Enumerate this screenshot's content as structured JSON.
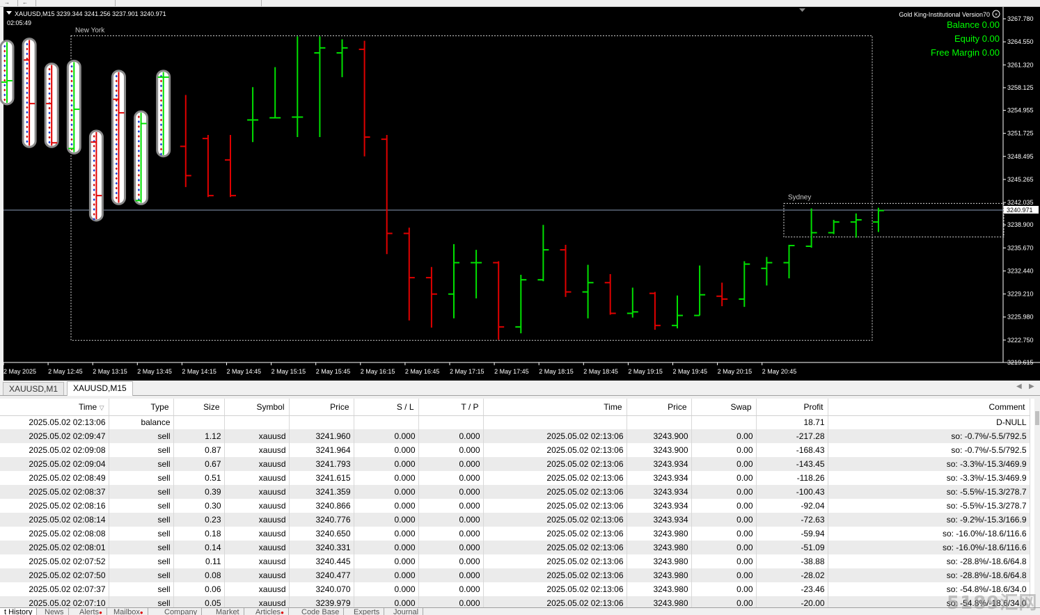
{
  "top_toolbar": {
    "items": [
      "→",
      "←"
    ]
  },
  "chart": {
    "symbol_info": "XAUUSD,M15  3239.344 3241.256 3237.901 3240.971",
    "countdown": "02:05:49",
    "indicator_name": "Gold King-Institutional Version70",
    "balance": "Balance 0.00",
    "equity": "Equity 0.00",
    "free_margin": "Free Margin 0.00",
    "sessions": [
      "New York",
      "Sydney"
    ],
    "current_price_label": "3240.971",
    "colors": {
      "bull": "#00e000",
      "bear": "#e00000",
      "info": "#00ff00",
      "grid": "#ffffff",
      "price_line": "#8a9bb8"
    }
  },
  "chart_data": {
    "type": "ohlc",
    "title": "XAUUSD,M15",
    "ylim": [
      3219.615,
      3267.78
    ],
    "y_ticks": [
      "3267.780",
      "3264.550",
      "3261.320",
      "3258.125",
      "3254.955",
      "3251.725",
      "3248.495",
      "3245.265",
      "3242.035",
      "3238.900",
      "3235.670",
      "3232.440",
      "3229.210",
      "3225.980",
      "3222.750",
      "3219.615"
    ],
    "x_ticks": [
      "2 May 2025",
      "2 May 12:45",
      "2 May 13:15",
      "2 May 13:45",
      "2 May 14:15",
      "2 May 14:45",
      "2 May 15:15",
      "2 May 15:45",
      "2 May 16:15",
      "2 May 16:45",
      "2 May 17:15",
      "2 May 17:45",
      "2 May 18:15",
      "2 May 18:45",
      "2 May 19:15",
      "2 May 19:45",
      "2 May 20:15",
      "2 May 20:45"
    ],
    "bars": [
      {
        "o": 3258.9,
        "h": 3264.5,
        "l": 3256.0,
        "c": 3259.1
      },
      {
        "o": 3262.0,
        "h": 3264.8,
        "l": 3250.0,
        "c": 3255.9
      },
      {
        "o": 3255.9,
        "h": 3261.3,
        "l": 3250.0,
        "c": 3250.4
      },
      {
        "o": 3249.6,
        "h": 3261.7,
        "l": 3249.1,
        "c": 3255.1
      },
      {
        "o": 3250.5,
        "h": 3251.9,
        "l": 3239.7,
        "c": 3243.0
      },
      {
        "o": 3256.5,
        "h": 3260.3,
        "l": 3242.0,
        "c": 3254.6
      },
      {
        "o": 3242.3,
        "h": 3254.6,
        "l": 3242.0,
        "c": 3253.1
      },
      {
        "o": 3259.6,
        "h": 3260.3,
        "l": 3248.7,
        "c": 3259.6
      },
      {
        "o": 3249.9,
        "h": 3257.1,
        "l": 3244.2,
        "c": 3245.8
      },
      {
        "o": 3251.0,
        "h": 3251.5,
        "l": 3242.8,
        "c": 3243.0
      },
      {
        "o": 3248.0,
        "h": 3251.5,
        "l": 3242.8,
        "c": 3243.0
      },
      {
        "o": 3253.6,
        "h": 3258.2,
        "l": 3250.5,
        "c": 3253.6
      },
      {
        "o": 3253.9,
        "h": 3261.0,
        "l": 3253.9,
        "c": 3253.9
      },
      {
        "o": 3254.0,
        "h": 3265.3,
        "l": 3251.2,
        "c": 3254.0
      },
      {
        "o": 3263.0,
        "h": 3265.3,
        "l": 3251.2,
        "c": 3263.7
      },
      {
        "o": 3263.0,
        "h": 3264.9,
        "l": 3259.6,
        "c": 3263.7
      },
      {
        "o": 3263.5,
        "h": 3264.7,
        "l": 3248.5,
        "c": 3251.2
      },
      {
        "o": 3250.9,
        "h": 3251.5,
        "l": 3234.8,
        "c": 3237.7
      },
      {
        "o": 3237.7,
        "h": 3238.5,
        "l": 3225.5,
        "c": 3231.5
      },
      {
        "o": 3231.5,
        "h": 3233.0,
        "l": 3224.5,
        "c": 3229.2
      },
      {
        "o": 3229.2,
        "h": 3236.2,
        "l": 3225.8,
        "c": 3233.6
      },
      {
        "o": 3233.6,
        "h": 3235.4,
        "l": 3228.6,
        "c": 3233.6
      },
      {
        "o": 3233.6,
        "h": 3233.8,
        "l": 3222.8,
        "c": 3224.6
      },
      {
        "o": 3224.6,
        "h": 3231.9,
        "l": 3223.7,
        "c": 3231.2
      },
      {
        "o": 3231.2,
        "h": 3238.9,
        "l": 3231.0,
        "c": 3235.4
      },
      {
        "o": 3235.4,
        "h": 3236.1,
        "l": 3228.8,
        "c": 3229.5
      },
      {
        "o": 3229.5,
        "h": 3233.3,
        "l": 3225.8,
        "c": 3230.8
      },
      {
        "o": 3230.8,
        "h": 3232.0,
        "l": 3226.3,
        "c": 3226.5
      },
      {
        "o": 3226.5,
        "h": 3230.1,
        "l": 3225.9,
        "c": 3226.7
      },
      {
        "o": 3229.3,
        "h": 3229.5,
        "l": 3224.2,
        "c": 3224.8
      },
      {
        "o": 3224.8,
        "h": 3229.0,
        "l": 3224.4,
        "c": 3226.2
      },
      {
        "o": 3226.2,
        "h": 3233.2,
        "l": 3226.2,
        "c": 3229.1
      },
      {
        "o": 3228.9,
        "h": 3230.8,
        "l": 3227.5,
        "c": 3228.5
      },
      {
        "o": 3228.5,
        "h": 3233.8,
        "l": 3227.4,
        "c": 3233.4
      },
      {
        "o": 3232.8,
        "h": 3234.4,
        "l": 3230.4,
        "c": 3233.6
      },
      {
        "o": 3233.6,
        "h": 3236.1,
        "l": 3231.4,
        "c": 3236.0
      },
      {
        "o": 3235.9,
        "h": 3241.2,
        "l": 3235.7,
        "c": 3237.8
      },
      {
        "o": 3237.8,
        "h": 3239.6,
        "l": 3237.6,
        "c": 3239.3
      },
      {
        "o": 3239.3,
        "h": 3240.5,
        "l": 3237.1,
        "c": 3239.6
      },
      {
        "o": 3239.3,
        "h": 3241.3,
        "l": 3237.9,
        "c": 3240.9
      }
    ]
  },
  "symbol_tabs": [
    "XAUUSD,M1",
    "XAUUSD,M15"
  ],
  "table": {
    "headers": [
      "Time",
      "Type",
      "Size",
      "Symbol",
      "Price",
      "S / L",
      "T / P",
      "Time",
      "Price",
      "Swap",
      "Profit",
      "Comment"
    ],
    "rows": [
      [
        "2025.05.02 02:13:06",
        "balance",
        "",
        "",
        "",
        "",
        "",
        "",
        "",
        "",
        "18.71",
        "D-NULL"
      ],
      [
        "2025.05.02 02:09:47",
        "sell",
        "1.12",
        "xauusd",
        "3241.960",
        "0.000",
        "0.000",
        "2025.05.02 02:13:06",
        "3243.900",
        "0.00",
        "-217.28",
        "so: -0.7%/-5.5/792.5"
      ],
      [
        "2025.05.02 02:09:08",
        "sell",
        "0.87",
        "xauusd",
        "3241.964",
        "0.000",
        "0.000",
        "2025.05.02 02:13:06",
        "3243.900",
        "0.00",
        "-168.43",
        "so: -0.7%/-5.5/792.5"
      ],
      [
        "2025.05.02 02:09:04",
        "sell",
        "0.67",
        "xauusd",
        "3241.793",
        "0.000",
        "0.000",
        "2025.05.02 02:13:06",
        "3243.934",
        "0.00",
        "-143.45",
        "so: -3.3%/-15.3/469.9"
      ],
      [
        "2025.05.02 02:08:49",
        "sell",
        "0.51",
        "xauusd",
        "3241.615",
        "0.000",
        "0.000",
        "2025.05.02 02:13:06",
        "3243.934",
        "0.00",
        "-118.26",
        "so: -3.3%/-15.3/469.9"
      ],
      [
        "2025.05.02 02:08:37",
        "sell",
        "0.39",
        "xauusd",
        "3241.359",
        "0.000",
        "0.000",
        "2025.05.02 02:13:06",
        "3243.934",
        "0.00",
        "-100.43",
        "so: -5.5%/-15.3/278.7"
      ],
      [
        "2025.05.02 02:08:16",
        "sell",
        "0.30",
        "xauusd",
        "3240.866",
        "0.000",
        "0.000",
        "2025.05.02 02:13:06",
        "3243.934",
        "0.00",
        "-92.04",
        "so: -5.5%/-15.3/278.7"
      ],
      [
        "2025.05.02 02:08:14",
        "sell",
        "0.23",
        "xauusd",
        "3240.776",
        "0.000",
        "0.000",
        "2025.05.02 02:13:06",
        "3243.934",
        "0.00",
        "-72.63",
        "so: -9.2%/-15.3/166.9"
      ],
      [
        "2025.05.02 02:08:08",
        "sell",
        "0.18",
        "xauusd",
        "3240.650",
        "0.000",
        "0.000",
        "2025.05.02 02:13:06",
        "3243.980",
        "0.00",
        "-59.94",
        "so: -16.0%/-18.6/116.6"
      ],
      [
        "2025.05.02 02:08:01",
        "sell",
        "0.14",
        "xauusd",
        "3240.331",
        "0.000",
        "0.000",
        "2025.05.02 02:13:06",
        "3243.980",
        "0.00",
        "-51.09",
        "so: -16.0%/-18.6/116.6"
      ],
      [
        "2025.05.02 02:07:52",
        "sell",
        "0.11",
        "xauusd",
        "3240.445",
        "0.000",
        "0.000",
        "2025.05.02 02:13:06",
        "3243.980",
        "0.00",
        "-38.88",
        "so: -28.8%/-18.6/64.8"
      ],
      [
        "2025.05.02 02:07:50",
        "sell",
        "0.08",
        "xauusd",
        "3240.477",
        "0.000",
        "0.000",
        "2025.05.02 02:13:06",
        "3243.980",
        "0.00",
        "-28.02",
        "so: -28.8%/-18.6/64.8"
      ],
      [
        "2025.05.02 02:07:37",
        "sell",
        "0.06",
        "xauusd",
        "3240.070",
        "0.000",
        "0.000",
        "2025.05.02 02:13:06",
        "3243.980",
        "0.00",
        "-23.46",
        "so: -54.8%/-18.6/34.0"
      ],
      [
        "2025.05.02 02:07:10",
        "sell",
        "0.05",
        "xauusd",
        "3239.979",
        "0.000",
        "0.000",
        "2025.05.02 02:13:06",
        "3243.980",
        "0.00",
        "-20.00",
        "so: -54.8%/-18.6/34.0"
      ]
    ]
  },
  "bottom_tabs": [
    "t History",
    "News",
    "Alerts",
    "Mailbox",
    "Company",
    "Market",
    "Articles",
    "Code Base",
    "Experts",
    "Journal"
  ],
  "watermark": "5189汇网"
}
